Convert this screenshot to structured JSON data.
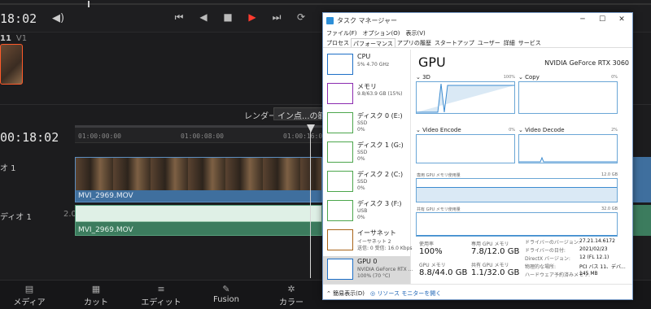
{
  "editor": {
    "timecode_top": "18:02",
    "clip": {
      "index": "11",
      "track": "V1"
    },
    "render_label": "レンダー",
    "render_value": "イン点...の範囲",
    "timecode_big": "00:18:02",
    "ruler": [
      "01:00:00:00",
      "01:00:08:00",
      "01:00:16:00"
    ],
    "tracks": {
      "video": "オ 1",
      "audio": "ディオ 1",
      "audio_level": "2.0"
    },
    "video_clip_name": "MVI_2969.MOV",
    "audio_clip_name": "MVI_2969.MOV",
    "nav": [
      "メディア",
      "カット",
      "エディット",
      "Fusion",
      "カラー"
    ]
  },
  "taskmgr": {
    "title": "タスク マネージャー",
    "menu": [
      "ファイル(F)",
      "オプション(O)",
      "表示(V)"
    ],
    "tabs": [
      "プロセス",
      "パフォーマンス",
      "アプリの履歴",
      "スタートアップ",
      "ユーザー",
      "詳細",
      "サービス"
    ],
    "active_tab": 1,
    "sidebar": [
      {
        "name": "CPU",
        "sub1": "5% 4.70 GHz",
        "sub2": "",
        "color": "#1d6fc7"
      },
      {
        "name": "メモリ",
        "sub1": "9.8/63.9 GB (15%)",
        "sub2": "",
        "color": "#8b2bb0"
      },
      {
        "name": "ディスク 0 (E:)",
        "sub1": "SSD",
        "sub2": "0%",
        "color": "#4ca64c"
      },
      {
        "name": "ディスク 1 (G:)",
        "sub1": "SSD",
        "sub2": "0%",
        "color": "#4ca64c"
      },
      {
        "name": "ディスク 2 (C:)",
        "sub1": "SSD",
        "sub2": "0%",
        "color": "#4ca64c"
      },
      {
        "name": "ディスク 3 (F:)",
        "sub1": "USB",
        "sub2": "0%",
        "color": "#4ca64c"
      },
      {
        "name": "イーサネット",
        "sub1": "イーサネット 2",
        "sub2": "送信: 0 受信: 16.0 Kbps",
        "color": "#a86418"
      },
      {
        "name": "GPU 0",
        "sub1": "NVIDIA GeForce RTX ...",
        "sub2": "100% (70 °C)",
        "color": "#1d6fc7"
      }
    ],
    "gpu_title": "GPU",
    "gpu_model": "NVIDIA GeForce RTX 3060",
    "engines": [
      {
        "name": "3D",
        "pct": "100%"
      },
      {
        "name": "Copy",
        "pct": "0%"
      },
      {
        "name": "Video Encode",
        "pct": "0%"
      },
      {
        "name": "Video Decode",
        "pct": "2%"
      }
    ],
    "dedicated_mem_label": "専用 GPU メモリ使用量",
    "dedicated_mem_max": "12.0 GB",
    "shared_mem_label": "共有 GPU メモリ使用量",
    "shared_mem_max": "32.0 GB",
    "stats": {
      "util_label": "使用率",
      "util": "100%",
      "dedicated_label": "専用 GPU メモリ",
      "dedicated": "7.8/12.0 GB",
      "gpu_mem_label": "GPU メモリ",
      "gpu_mem": "8.8/44.0 GB",
      "shared_label": "共有 GPU メモリ",
      "shared": "1.1/32.0 GB"
    },
    "info": [
      {
        "label": "ドライバーのバージョン:",
        "value": "27.21.14.6172"
      },
      {
        "label": "ドライバーの日付:",
        "value": "2021/02/23"
      },
      {
        "label": "DirectX バージョン:",
        "value": "12 (FL 12.1)"
      },
      {
        "label": "物理的な場所:",
        "value": "PCI バス 11、デバ..."
      },
      {
        "label": "ハードウェア予約済みメモリ:",
        "value": "145 MB"
      }
    ],
    "footer_brief": "簡易表示(D)",
    "footer_monitor": "リソース モニターを開く"
  }
}
